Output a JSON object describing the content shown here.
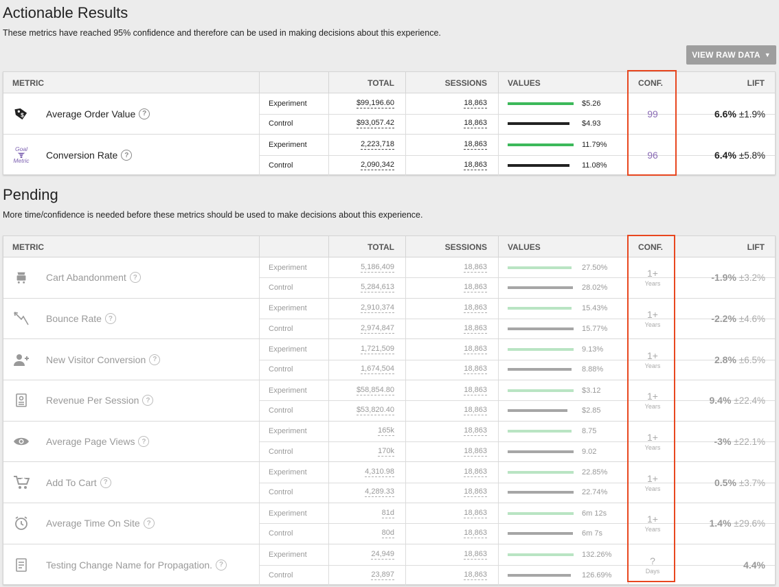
{
  "actionable": {
    "title": "Actionable Results",
    "description": "These metrics have reached 95% confidence and therefore can be used in making decisions about this experience.",
    "raw_button": "VIEW RAW DATA",
    "columns": {
      "metric": "METRIC",
      "total": "TOTAL",
      "sessions": "SESSIONS",
      "values": "VALUES",
      "conf": "CONF.",
      "lift": "LIFT"
    },
    "rows": [
      {
        "icon": "price-tag-icon",
        "name": "Average Order Value",
        "exp": {
          "label": "Experiment",
          "total": "$99,196.60",
          "sessions": "18,863",
          "bar": 0.96,
          "value": "$5.26"
        },
        "ctl": {
          "label": "Control",
          "total": "$93,057.42",
          "sessions": "18,863",
          "bar": 0.9,
          "value": "$4.93"
        },
        "conf": "99",
        "lift": "6.6%",
        "pm": "±1.9%"
      },
      {
        "icon": "goal-metric-funnel-icon",
        "icon_text_1": "Goal",
        "icon_text_2": "Metric",
        "name": "Conversion Rate",
        "exp": {
          "label": "Experiment",
          "total": "2,223,718",
          "sessions": "18,863",
          "bar": 0.96,
          "value": "11.79%"
        },
        "ctl": {
          "label": "Control",
          "total": "2,090,342",
          "sessions": "18,863",
          "bar": 0.9,
          "value": "11.08%"
        },
        "conf": "96",
        "lift": "6.4%",
        "pm": "±5.8%"
      }
    ]
  },
  "pending": {
    "title": "Pending",
    "description": "More time/confidence is needed before these metrics should be used to make decisions about this experience.",
    "columns": {
      "metric": "METRIC",
      "total": "TOTAL",
      "sessions": "SESSIONS",
      "values": "VALUES",
      "conf": "CONF.",
      "lift": "LIFT"
    },
    "rows": [
      {
        "icon": "cart-abandon-icon",
        "name": "Cart Abandonment",
        "exp": {
          "label": "Experiment",
          "total": "5,186,409",
          "sessions": "18,863",
          "bar": 0.93,
          "value": "27.50%"
        },
        "ctl": {
          "label": "Control",
          "total": "5,284,613",
          "sessions": "18,863",
          "bar": 0.95,
          "value": "28.02%"
        },
        "conf": "1+",
        "conf_unit": "Years",
        "lift": "-1.9%",
        "pm": "±3.2%"
      },
      {
        "icon": "bounce-arrow-icon",
        "name": "Bounce Rate",
        "exp": {
          "label": "Experiment",
          "total": "2,910,374",
          "sessions": "18,863",
          "bar": 0.93,
          "value": "15.43%"
        },
        "ctl": {
          "label": "Control",
          "total": "2,974,847",
          "sessions": "18,863",
          "bar": 0.96,
          "value": "15.77%"
        },
        "conf": "1+",
        "conf_unit": "Years",
        "lift": "-2.2%",
        "pm": "±4.6%"
      },
      {
        "icon": "add-user-icon",
        "name": "New Visitor Conversion",
        "exp": {
          "label": "Experiment",
          "total": "1,721,509",
          "sessions": "18,863",
          "bar": 0.96,
          "value": "9.13%"
        },
        "ctl": {
          "label": "Control",
          "total": "1,674,504",
          "sessions": "18,863",
          "bar": 0.93,
          "value": "8.88%"
        },
        "conf": "1+",
        "conf_unit": "Years",
        "lift": "2.8%",
        "pm": "±6.5%"
      },
      {
        "icon": "receipt-icon",
        "name": "Revenue Per Session",
        "exp": {
          "label": "Experiment",
          "total": "$58,854.80",
          "sessions": "18,863",
          "bar": 0.96,
          "value": "$3.12"
        },
        "ctl": {
          "label": "Control",
          "total": "$53,820.40",
          "sessions": "18,863",
          "bar": 0.87,
          "value": "$2.85"
        },
        "conf": "1+",
        "conf_unit": "Years",
        "lift": "9.4%",
        "pm": "±22.4%"
      },
      {
        "icon": "eye-icon",
        "name": "Average Page Views",
        "exp": {
          "label": "Experiment",
          "total": "165k",
          "sessions": "18,863",
          "bar": 0.93,
          "value": "8.75"
        },
        "ctl": {
          "label": "Control",
          "total": "170k",
          "sessions": "18,863",
          "bar": 0.96,
          "value": "9.02"
        },
        "conf": "1+",
        "conf_unit": "Years",
        "lift": "-3%",
        "pm": "±22.1%"
      },
      {
        "icon": "add-to-cart-icon",
        "name": "Add To Cart",
        "exp": {
          "label": "Experiment",
          "total": "4,310.98",
          "sessions": "18,863",
          "bar": 0.96,
          "value": "22.85%"
        },
        "ctl": {
          "label": "Control",
          "total": "4,289.33",
          "sessions": "18,863",
          "bar": 0.96,
          "value": "22.74%"
        },
        "conf": "1+",
        "conf_unit": "Years",
        "lift": "0.5%",
        "pm": "±3.7%"
      },
      {
        "icon": "alarm-clock-icon",
        "name": "Average Time On Site",
        "exp": {
          "label": "Experiment",
          "total": "81d",
          "sessions": "18,863",
          "bar": 0.96,
          "value": "6m 12s"
        },
        "ctl": {
          "label": "Control",
          "total": "80d",
          "sessions": "18,863",
          "bar": 0.95,
          "value": "6m 7s"
        },
        "conf": "1+",
        "conf_unit": "Years",
        "lift": "1.4%",
        "pm": "±29.6%"
      },
      {
        "icon": "document-icon",
        "name": "Testing Change Name for Propagation.",
        "exp": {
          "label": "Experiment",
          "total": "24,949",
          "sessions": "18,863",
          "bar": 0.96,
          "value": "132.26%"
        },
        "ctl": {
          "label": "Control",
          "total": "23,897",
          "sessions": "18,863",
          "bar": 0.92,
          "value": "126.69%"
        },
        "conf": "?",
        "conf_unit": "Days",
        "lift": "4.4%",
        "pm": ""
      }
    ]
  },
  "colors": {
    "exp_bar_strong": "#3cb95a",
    "ctl_bar_strong": "#222222",
    "exp_bar_faded": "#b9e4c3",
    "ctl_bar_faded": "#a6a6a6",
    "highlight": "#e8461e",
    "conf_text": "#8a6bb5"
  }
}
